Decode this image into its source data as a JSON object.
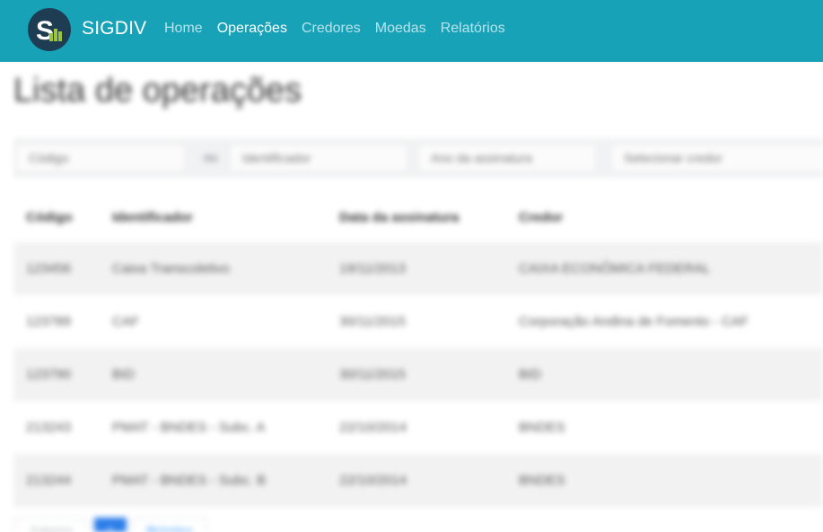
{
  "navbar": {
    "brand": "SIGDIV",
    "links": [
      {
        "label": "Home",
        "active": false
      },
      {
        "label": "Operações",
        "active": true
      },
      {
        "label": "Credores",
        "active": false
      },
      {
        "label": "Moedas",
        "active": false
      },
      {
        "label": "Relatórios",
        "active": false
      }
    ],
    "background": "#17a2b8"
  },
  "page": {
    "title": "Lista de operações"
  },
  "filters": {
    "code_placeholder": "Código",
    "separator": "ou",
    "identifier_placeholder": "Identificador",
    "year_placeholder": "Ano da assinatura",
    "creditor_placeholder": "Selecionar credor"
  },
  "table": {
    "headers": [
      "Código",
      "Identificador",
      "Data da assinatura",
      "Credor"
    ],
    "rows": [
      [
        "123456",
        "Caixa Transcoletivo",
        "19/11/2013",
        "CAIXA ECONÔMICA FEDERAL"
      ],
      [
        "123789",
        "CAF",
        "30/11/2015",
        "Corporação Andina de Fomento - CAF"
      ],
      [
        "123790",
        "BID",
        "30/11/2015",
        "BID"
      ],
      [
        "213243",
        "PMAT - BNDES - Subc. A",
        "22/10/2014",
        "BNDES"
      ],
      [
        "213244",
        "PMAT - BNDES - Subc. B",
        "22/10/2014",
        "BNDES"
      ]
    ]
  },
  "pagination": {
    "prev": "Anterior",
    "current": "1",
    "next": "Próxima"
  }
}
